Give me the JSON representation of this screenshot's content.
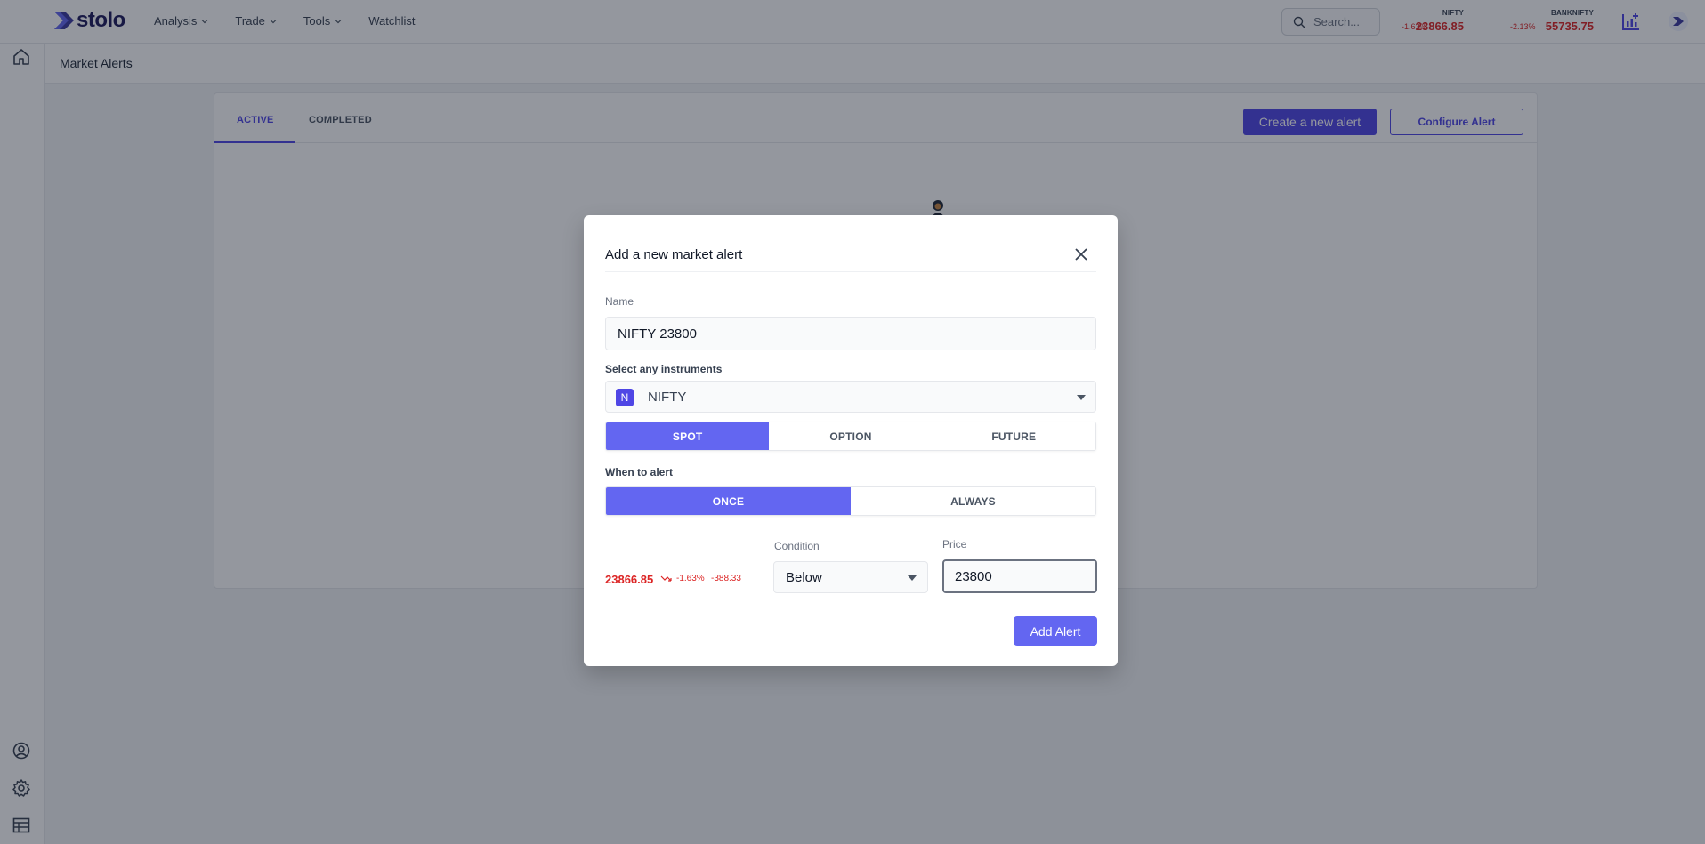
{
  "app": {
    "logo_text": "stolo",
    "brand_color": "#4f46e5"
  },
  "nav": {
    "items": [
      {
        "label": "Analysis",
        "has_dropdown": true
      },
      {
        "label": "Trade",
        "has_dropdown": true
      },
      {
        "label": "Tools",
        "has_dropdown": true
      },
      {
        "label": "Watchlist",
        "has_dropdown": false
      }
    ]
  },
  "search": {
    "placeholder": "Search..."
  },
  "tickers": [
    {
      "name": "NIFTY",
      "change": "-1.63%",
      "value": "23866.85"
    },
    {
      "name": "BANKNIFTY",
      "change": "-2.13%",
      "value": "55735.75"
    }
  ],
  "sidebar": {
    "top_icons": [
      "home-icon"
    ],
    "bottom_icons": [
      "user-circle-icon",
      "gear-icon",
      "table-icon"
    ]
  },
  "page": {
    "title": "Market Alerts",
    "tabs": [
      {
        "label": "ACTIVE",
        "active": true
      },
      {
        "label": "COMPLETED",
        "active": false
      }
    ],
    "create_button": "Create a new alert",
    "configure_button": "Configure Alert"
  },
  "modal": {
    "title": "Add a new market alert",
    "name_label": "Name",
    "name_value": "NIFTY 23800",
    "instrument_label": "Select any instruments",
    "instrument_badge": "N",
    "instrument_value": "NIFTY",
    "instrument_types": [
      {
        "label": "SPOT",
        "selected": true
      },
      {
        "label": "OPTION",
        "selected": false
      },
      {
        "label": "FUTURE",
        "selected": false
      }
    ],
    "when_label": "When to alert",
    "when_options": [
      {
        "label": "ONCE",
        "selected": true
      },
      {
        "label": "ALWAYS",
        "selected": false
      }
    ],
    "current_price": "23866.85",
    "current_change_pct": "-1.63%",
    "current_change_abs": "-388.33",
    "condition_label": "Condition",
    "condition_value": "Below",
    "price_label": "Price",
    "price_value": "23800",
    "submit_button": "Add Alert"
  },
  "colors": {
    "negative": "#dc2626",
    "accent": "#6366f1"
  }
}
